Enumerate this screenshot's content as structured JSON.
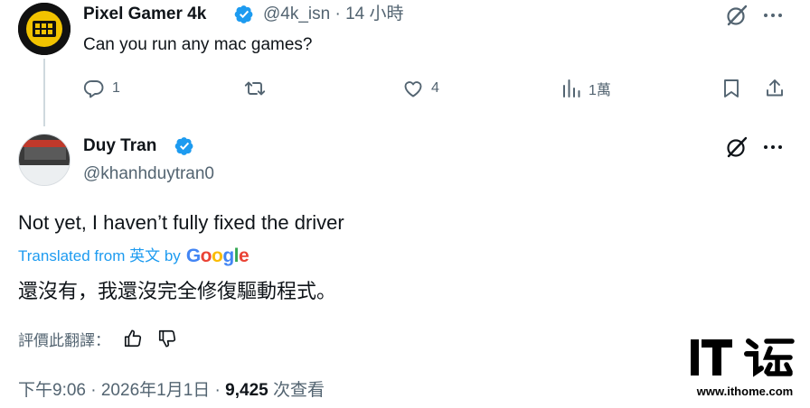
{
  "reply": {
    "author_name": "Pixel Gamer 4k",
    "handle_time": "@4k_isn · 14 小時",
    "text": "Can you run any mac games?",
    "actions": {
      "replies": "1",
      "reposts": "",
      "likes": "4",
      "views": "1萬"
    }
  },
  "tweet": {
    "author_name": "Duy Tran",
    "handle": "@khanhduytran0",
    "text": "Not yet, I haven’t fully fixed the driver",
    "translated_from": "Translated from 英文 by",
    "google_logo": "Google",
    "translation": "還沒有，我還沒完全修復驅動程式。",
    "rate_label": "評價此翻譯：",
    "timestamp": "下午9:06 · 2026年1月1日 · ",
    "view_count": "9,425",
    "views_label": " 次查看"
  },
  "watermark": {
    "url": "www.ithome.com"
  },
  "colors": {
    "accent": "#1d9bf0",
    "muted": "#536471",
    "text": "#0f1419"
  },
  "icons": [
    "verified-badge-icon",
    "grok-icon",
    "more-icon",
    "reply-icon",
    "repost-icon",
    "like-icon",
    "views-icon",
    "bookmark-icon",
    "share-icon",
    "thumbs-up-icon",
    "thumbs-down-icon"
  ]
}
